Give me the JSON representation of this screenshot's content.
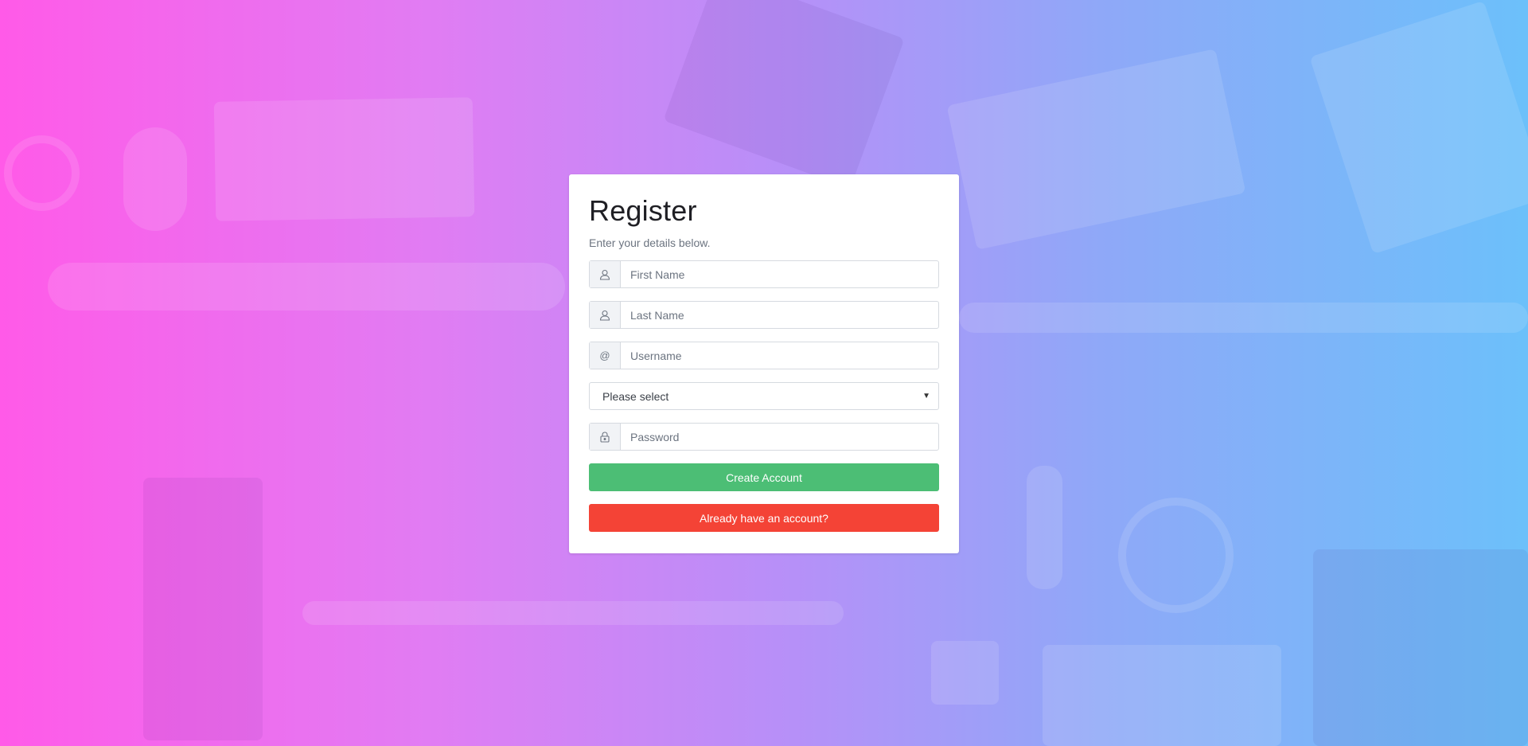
{
  "form": {
    "title": "Register",
    "subtitle": "Enter your details below.",
    "fields": [
      {
        "icon": "user-icon",
        "placeholder": "First Name",
        "value": ""
      },
      {
        "icon": "user-icon",
        "placeholder": "Last Name",
        "value": ""
      },
      {
        "icon": "at-icon",
        "placeholder": "Username",
        "value": ""
      }
    ],
    "select": {
      "selected": "Please select"
    },
    "password": {
      "icon": "lock-icon",
      "placeholder": "Password",
      "value": ""
    },
    "create_button": "Create Account",
    "login_button": "Already have an account?"
  },
  "colors": {
    "primary_button": "#4cbe75",
    "secondary_button": "#f44336",
    "gradient_left": "#ff5ae8",
    "gradient_right": "#6cc0fa"
  }
}
